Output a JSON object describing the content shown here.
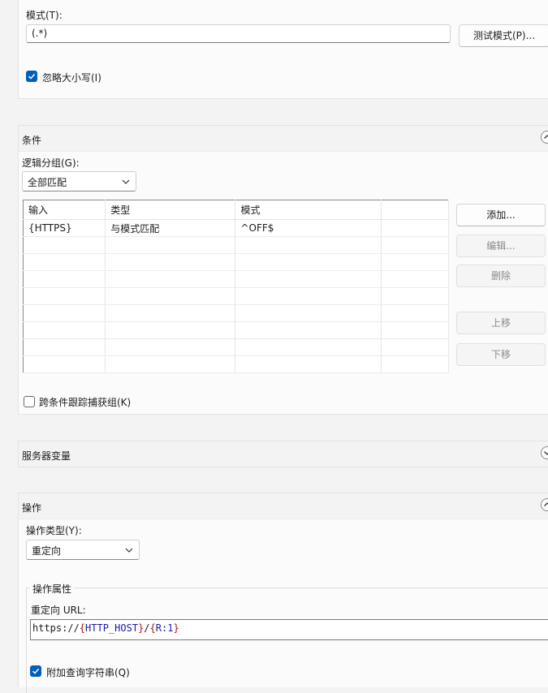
{
  "pattern_section": {
    "pattern_label": "模式(T):",
    "pattern_value": "(.*)",
    "test_button": "测试模式(P)...",
    "ignore_case_label": "忽略大小写(I)",
    "ignore_case_checked": true
  },
  "conditions": {
    "title": "条件",
    "logical_grouping_label": "逻辑分组(G):",
    "logical_grouping_value": "全部匹配",
    "columns": [
      "输入",
      "类型",
      "模式",
      ""
    ],
    "rows": [
      [
        "{HTTPS}",
        "与模式匹配",
        "^OFF$",
        ""
      ]
    ],
    "buttons": {
      "add": "添加...",
      "edit": "编辑...",
      "remove": "删除",
      "move_up": "上移",
      "move_down": "下移"
    },
    "track_groups_label": "跨条件跟踪捕获组(K)",
    "track_groups_checked": false
  },
  "server_variables": {
    "title": "服务器变量"
  },
  "action": {
    "title": "操作",
    "action_type_label": "操作类型(Y):",
    "action_type_value": "重定向",
    "properties_title": "操作属性",
    "redirect_url_label": "重定向 URL:",
    "redirect_url_parts": {
      "prefix": "https://",
      "open1": "{",
      "var1": "HTTP_HOST",
      "close1": "}",
      "slash": "/",
      "open2": "{",
      "var2": "R:1",
      "close2": "}"
    },
    "append_query_label": "附加查询字符串(Q)",
    "append_query_checked": true
  },
  "colors": {
    "accent": "#005fb8",
    "brace": "#a31515",
    "var": "#1a1aa6"
  }
}
